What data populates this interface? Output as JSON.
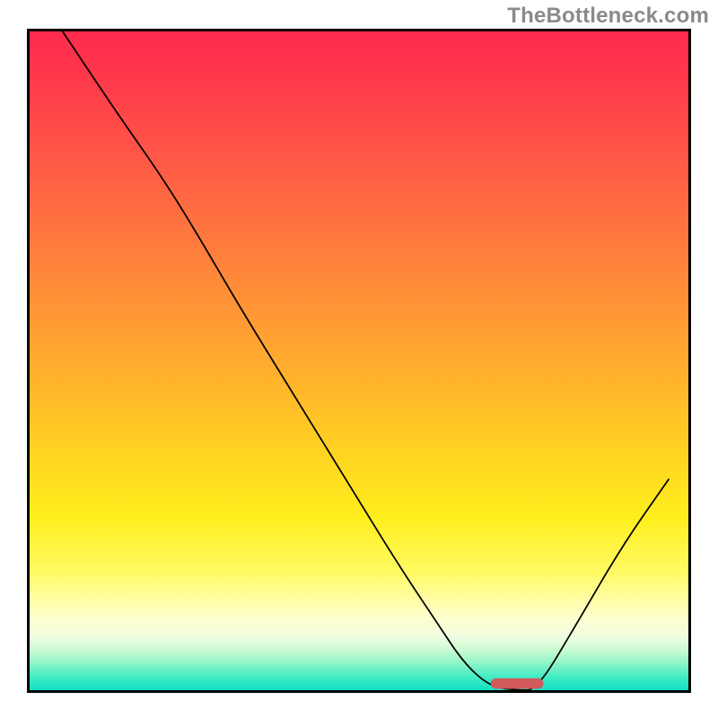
{
  "watermark": "TheBottleneck.com",
  "chart_data": {
    "type": "line",
    "title": "",
    "xlabel": "",
    "ylabel": "",
    "xlim": [
      0,
      1000
    ],
    "ylim": [
      0,
      1000
    ],
    "x": [
      50,
      130,
      200,
      250,
      320,
      400,
      480,
      560,
      620,
      660,
      700,
      740,
      770,
      830,
      900,
      970
    ],
    "values": [
      1000,
      880,
      780,
      700,
      580,
      450,
      320,
      190,
      100,
      40,
      5,
      0,
      0,
      100,
      220,
      320
    ],
    "optimum_marker": {
      "x_start": 700,
      "x_end": 780,
      "y": 0
    },
    "gradient_stops": [
      {
        "pos": 0.0,
        "color": "#ff2a4d"
      },
      {
        "pos": 0.5,
        "color": "#ffb92a"
      },
      {
        "pos": 0.8,
        "color": "#fffb63"
      },
      {
        "pos": 0.92,
        "color": "#eefde1"
      },
      {
        "pos": 1.0,
        "color": "#10e0c5"
      }
    ]
  }
}
